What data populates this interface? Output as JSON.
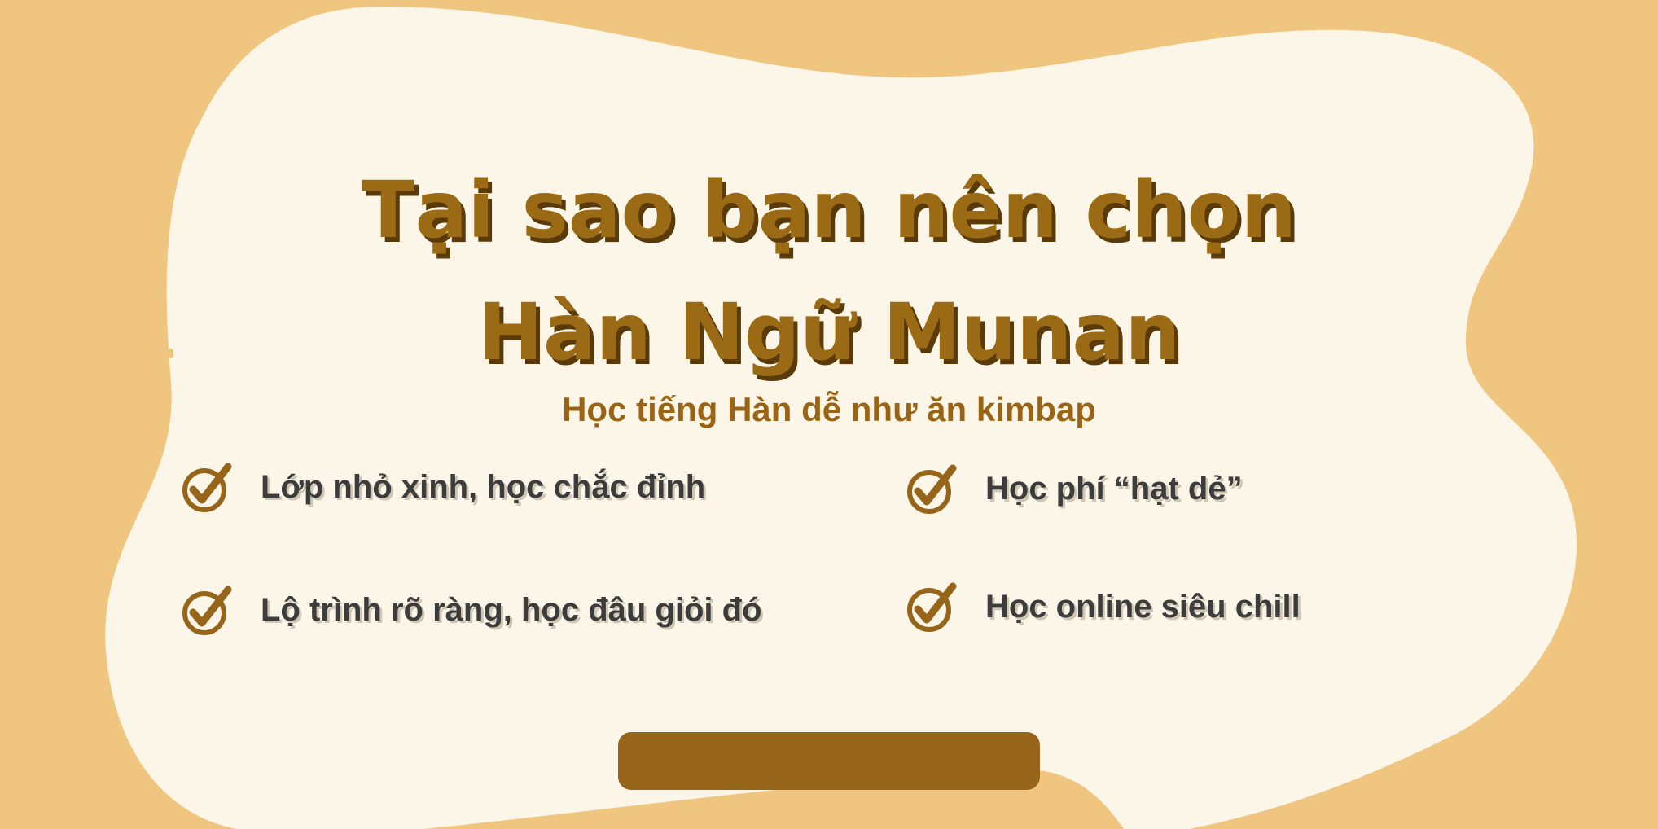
{
  "colors": {
    "background": "#f0c57f",
    "blob": "#fbf6e8",
    "title": "#9a6a14",
    "title_shadow": "#5a3a08",
    "subtitle": "#9a6414",
    "feature_text": "#3c3c3c",
    "check": "#97651a",
    "button": "#97651a"
  },
  "heading": {
    "line1": "Tại sao bạn nên chọn",
    "line2": "Hàn Ngữ Munan"
  },
  "subtitle": "Học tiếng Hàn dễ như ăn kimbap",
  "features": [
    {
      "icon": "checkmark-circle-icon",
      "label": "Lớp nhỏ xinh, học chắc đỉnh"
    },
    {
      "icon": "checkmark-circle-icon",
      "label": "Học phí “hạt dẻ”"
    },
    {
      "icon": "checkmark-circle-icon",
      "label": "Lộ trình rõ ràng, học đâu giỏi đó"
    },
    {
      "icon": "checkmark-circle-icon",
      "label": "Học online siêu chill"
    }
  ],
  "cta": {
    "label": ""
  }
}
